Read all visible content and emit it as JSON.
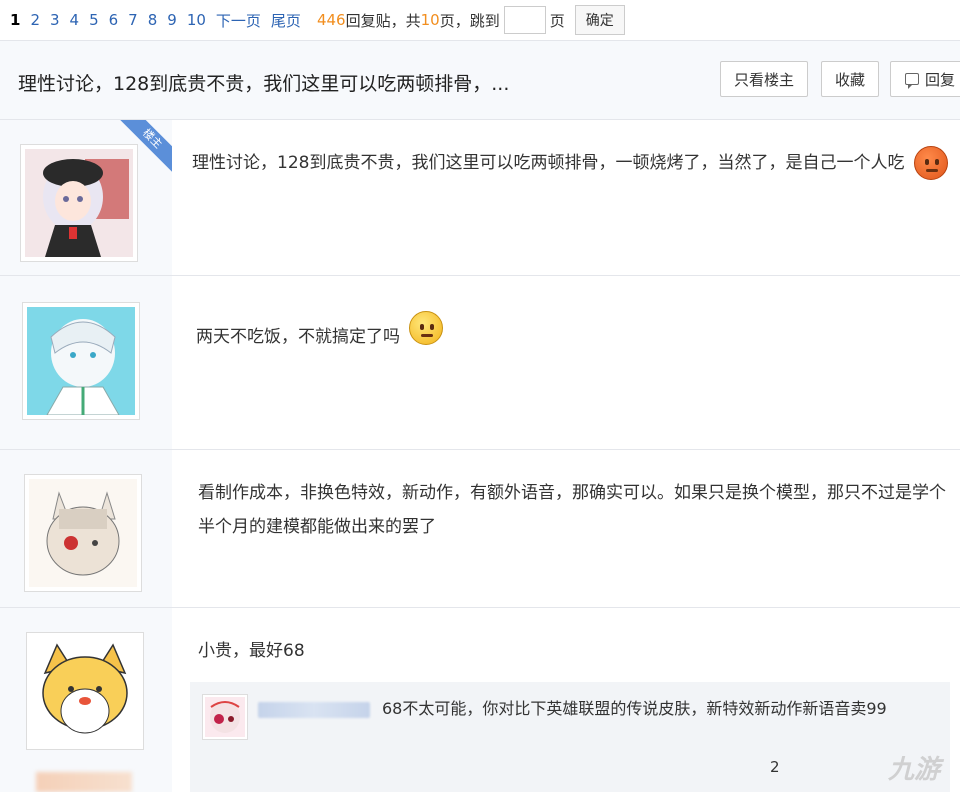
{
  "pager": {
    "pages": [
      "1",
      "2",
      "3",
      "4",
      "5",
      "6",
      "7",
      "8",
      "9",
      "10"
    ],
    "next": "下一页",
    "last": "尾页",
    "reply_count": "446",
    "reply_label": "回复贴，共",
    "total_pages": "10",
    "page_unit": "页",
    "jump_label": "，跳到",
    "jump_unit": "页",
    "confirm": "确定"
  },
  "thread": {
    "title": "理性讨论，128到底贵不贵，我们这里可以吃两顿排骨，...",
    "only_op": "只看楼主",
    "favorite": "收藏",
    "reply": "回复"
  },
  "posts": [
    {
      "badge": "楼主",
      "text": "理性讨论，128到底贵不贵，我们这里可以吃两顿排骨，一顿烧烤了，当然了，是自己一个人吃"
    },
    {
      "text": "两天不吃饭，不就搞定了吗"
    },
    {
      "text": "看制作成本，非换色特效，新动作，有额外语音，那确实可以。如果只是换个模型，那只不过是学个半个月的建模都能做出来的罢了"
    },
    {
      "text": "小贵，最好68"
    }
  ],
  "subreply": {
    "text": "68不太可能，你对比下英雄联盟的传说皮肤，新特效新动作新语音卖99",
    "number": "2"
  },
  "watermark": "九游",
  "colors": {
    "link": "#2d64b3",
    "accent": "#f28e1e",
    "badge": "#5b8fd9"
  }
}
